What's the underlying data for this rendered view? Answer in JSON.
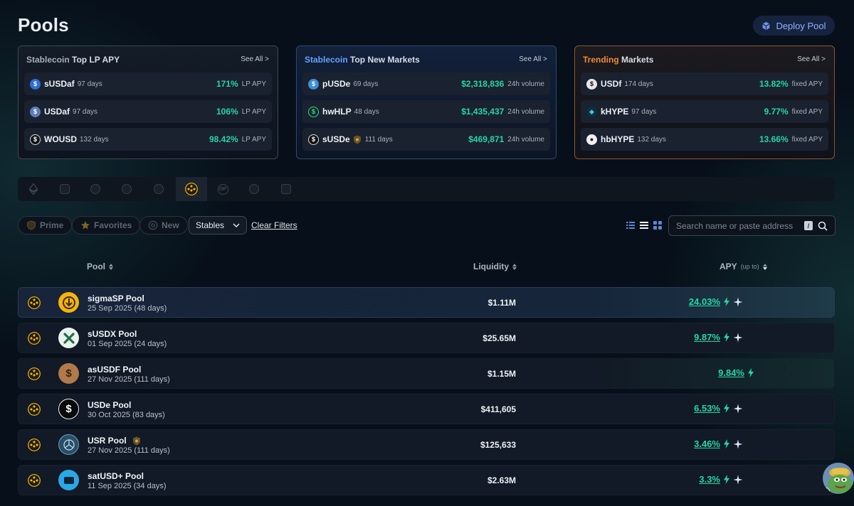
{
  "page": {
    "title": "Pools",
    "deploy_label": "Deploy Pool"
  },
  "cards": [
    {
      "title_highlight": "Stablecoin",
      "title_rest": " Top LP APY",
      "see_all": "See All >",
      "rows": [
        {
          "name": "sUSDaf",
          "days": "97 days",
          "value": "171%",
          "unit": "LP APY"
        },
        {
          "name": "USDaf",
          "days": "97 days",
          "value": "106%",
          "unit": "LP APY"
        },
        {
          "name": "WOUSD",
          "days": "132 days",
          "value": "98.42%",
          "unit": "LP APY"
        }
      ]
    },
    {
      "title_highlight": "Stablecoin",
      "title_rest": " Top New Markets",
      "see_all": "See All >",
      "rows": [
        {
          "name": "pUSDe",
          "days": "69 days",
          "value": "$2,318,836",
          "unit": "24h volume"
        },
        {
          "name": "hwHLP",
          "days": "48 days",
          "value": "$1,435,437",
          "unit": "24h volume"
        },
        {
          "name": "sUSDe",
          "days": "111 days",
          "value": "$469,871",
          "unit": "24h volume"
        }
      ]
    },
    {
      "title_highlight": "Trending",
      "title_rest": " Markets",
      "see_all": "See All >",
      "rows": [
        {
          "name": "USDf",
          "days": "174 days",
          "value": "13.82%",
          "unit": "fixed APY"
        },
        {
          "name": "kHYPE",
          "days": "97 days",
          "value": "9.77%",
          "unit": "fixed APY"
        },
        {
          "name": "hbHYPE",
          "days": "132 days",
          "value": "13.66%",
          "unit": "fixed APY"
        }
      ]
    }
  ],
  "chain_badge": "OP",
  "filters": {
    "prime": "Prime",
    "favorites": "Favorites",
    "new": "New",
    "stables": "Stables",
    "clear": "Clear Filters"
  },
  "search": {
    "placeholder": "Search name or paste address",
    "shortcut": "/"
  },
  "table": {
    "col_pool": "Pool",
    "col_liquidity": "Liquidity",
    "col_apy": "APY",
    "col_apy_note": "(up to)",
    "rows": [
      {
        "name": "sigmaSP Pool",
        "date": "25 Sep 2025 (48 days)",
        "liquidity": "$1.11M",
        "apy": "24.03%"
      },
      {
        "name": "sUSDX Pool",
        "date": "01 Sep 2025 (24 days)",
        "liquidity": "$25.65M",
        "apy": "9.87%"
      },
      {
        "name": "asUSDF Pool",
        "date": "27 Nov 2025 (111 days)",
        "liquidity": "$1.15M",
        "apy": "9.84%"
      },
      {
        "name": "USDe Pool",
        "date": "30 Oct 2025 (83 days)",
        "liquidity": "$411,605",
        "apy": "6.53%"
      },
      {
        "name": "USR Pool",
        "date": "27 Nov 2025 (111 days)",
        "liquidity": "$125,633",
        "apy": "3.46%"
      },
      {
        "name": "satUSD+ Pool",
        "date": "11 Sep 2025 (34 days)",
        "liquidity": "$2.63M",
        "apy": "3.3%"
      }
    ]
  },
  "colors": {
    "accent_green": "#27d5a5",
    "accent_blue": "#64a0ff",
    "accent_orange": "#ee8c3c",
    "bg": "#07101a"
  },
  "icons": [
    "cube-icon",
    "ethereum-icon",
    "bnb-icon",
    "shield-icon",
    "star-icon",
    "at-icon",
    "chevron-down-icon",
    "list-view-icon",
    "compact-view-icon",
    "grid-view-icon",
    "search-icon",
    "sort-icon",
    "bolt-icon",
    "sparkle-icon"
  ]
}
